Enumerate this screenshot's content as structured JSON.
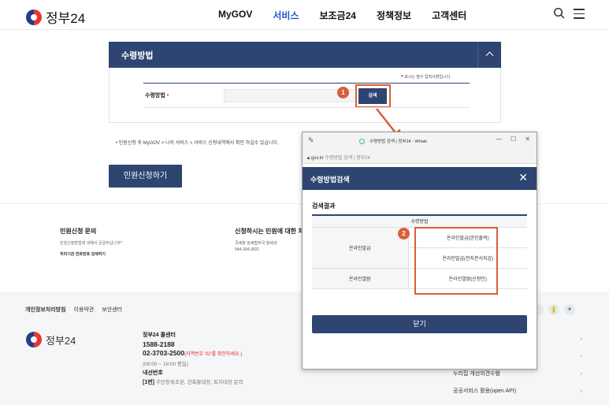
{
  "header": {
    "logo": "정부24",
    "nav": [
      "MyGOV",
      "서비스",
      "보조금24",
      "정책정보",
      "고객센터"
    ],
    "active_nav": "서비스"
  },
  "form": {
    "section_title": "수령방법",
    "required_note": "표시는 필수 입력사항입니다.",
    "method_label": "수령방법",
    "method_value": "",
    "search_label": "검색",
    "guide": "• 민원신청 후 MyGOV > 나의 서비스 > 서비스 신청내역에서 확인 하실수 있습니다.",
    "apply_label": "민원신청하기"
  },
  "annotations": {
    "badge1": "1",
    "badge2": "2",
    "accent_color": "#d95f38"
  },
  "info": {
    "left_title": "민원신청 문의",
    "left_sub": "민원신청방법에 대해서 궁금하십니까?",
    "left_link": "처리기관 전화번호 검색하기",
    "mid_title": "신청하시는 민원에 대한 처",
    "mid_line1": "국세청 징세법무국 징세과",
    "mid_line2": "044-204-3021"
  },
  "footer": {
    "links": [
      "개인정보처리방침",
      "이용약관",
      "보안센터"
    ],
    "logo": "정부24",
    "callcenter_title": "정부24 콜센터",
    "phone1": "1588-2188",
    "phone2": "02-3703-2500",
    "phone2_note": "(지역번호 '02'를 확인하세요.)",
    "hours": "(09:00 ~ 18:00 평일)",
    "ext_title": "내선번호",
    "ext1_num": "[1번]",
    "ext1_desc": "주민등록초본, 건축물대장, 토지대장 문의",
    "right_links": [
      "누리집 개선의견수렴",
      "공공서비스 활용(open API)"
    ]
  },
  "popup": {
    "tab_title": "수령방법 검색 | 정부24 - Whale",
    "url_host": "gov.kr",
    "url_title": "수령방법 검색 | 정부24",
    "header_title": "수령방법검색",
    "result_title": "검색결과",
    "table_header": "수령방법",
    "rows": [
      {
        "category": "온라인발급",
        "options": [
          "온라인발급(본인출력)",
          "온라인발급(전자문서지갑)"
        ]
      },
      {
        "category": "온라인열람",
        "options": [
          "온라인열람(신청인)"
        ]
      }
    ],
    "close_label": "닫기"
  }
}
